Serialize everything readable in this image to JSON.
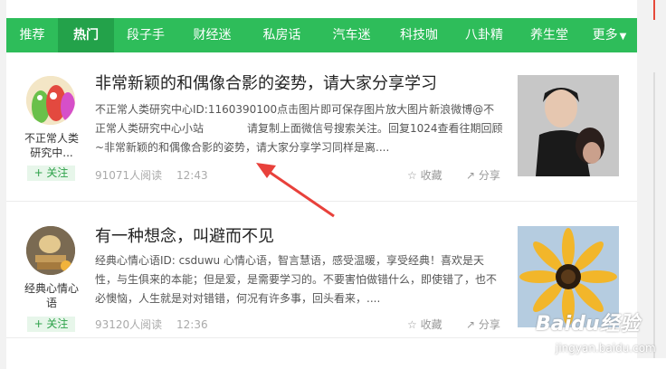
{
  "nav": {
    "items": [
      {
        "label": "推荐"
      },
      {
        "label": "热门"
      },
      {
        "label": "段子手"
      },
      {
        "label": "财经迷"
      },
      {
        "label": "私房话"
      },
      {
        "label": "汽车迷"
      },
      {
        "label": "科技咖"
      },
      {
        "label": "八卦精"
      },
      {
        "label": "养生堂"
      },
      {
        "label": "更多"
      }
    ],
    "active_index": 1
  },
  "articles": [
    {
      "author_line1": "不正常人类",
      "author_line2": "研究中...",
      "follow_label": "+ 关注",
      "title": "非常新颖的和偶像合影的姿势，请大家分享学习",
      "summary": "不正常人类研究中心ID:1160390100点击图片即可保存图片放大图片新浪微博@不正常人类研究中心小站　　　　请复制上面微信号搜索关注。回复1024查看往期回顾~非常新颖的和偶像合影的姿势，请大家分享学习同样是离....",
      "reads": "91071人阅读",
      "time": "12:43",
      "favorite_label": "收藏",
      "share_label": "分享"
    },
    {
      "author_line1": "经典心情心",
      "author_line2": "语",
      "follow_label": "+ 关注",
      "title": "有一种想念，叫避而不见",
      "summary": "经典心情心语ID: csduwu 心情心语，智言慧语，感受温暖，享受经典！喜欢是天性，与生俱来的本能；但是爱，是需要学习的。不要害怕做错什么，即使错了，也不必懊恼，人生就是对对错错，何况有许多事，回头看来，....",
      "reads": "93120人阅读",
      "time": "12:36",
      "favorite_label": "收藏",
      "share_label": "分享"
    }
  ],
  "watermark": {
    "brand": "Baidu经验",
    "url": "jingyan.baidu.com"
  },
  "colors": {
    "nav_bg": "#2ebd5a",
    "nav_active": "#23a24a",
    "arrow": "#e8413b",
    "follow_bg": "#e7f6ea"
  }
}
